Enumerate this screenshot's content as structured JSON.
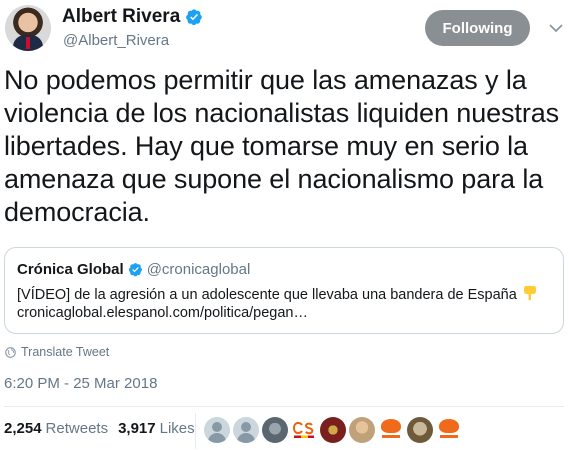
{
  "author": {
    "display_name": "Albert Rivera",
    "handle": "@Albert_Rivera"
  },
  "follow_button": {
    "label": "Following"
  },
  "tweet": {
    "text": "No podemos permitir que las amenazas y la violencia de los nacionalistas liquiden nuestras libertades. Hay que tomarse muy en serio la amenaza que supone el nacionalismo para la democracia."
  },
  "quoted_tweet": {
    "display_name": "Crónica Global",
    "handle": "@cronicaglobal",
    "line1": "[VÍDEO] de la agresión a un adolescente que llevaba una bandera de España",
    "line2": "cronicaglobal.elespanol.com/politica/pegan…"
  },
  "translate_label": "Translate Tweet",
  "timestamp": "6:20 PM - 25 Mar 2018",
  "stats": {
    "retweets_count": "2,254",
    "retweets_label": "Retweets",
    "likes_count": "3,917",
    "likes_label": "Likes"
  },
  "likers": [
    "cs-logo",
    "default",
    "default",
    "photo",
    "cs-logo",
    "photo",
    "photo",
    "cs-logo",
    "photo",
    "cs-logo"
  ],
  "colors": {
    "verified_blue": "#1da1f2",
    "follow_button_bg": "#8a8f94",
    "secondary_text": "#657786",
    "brand_orange": "#eb6109"
  }
}
